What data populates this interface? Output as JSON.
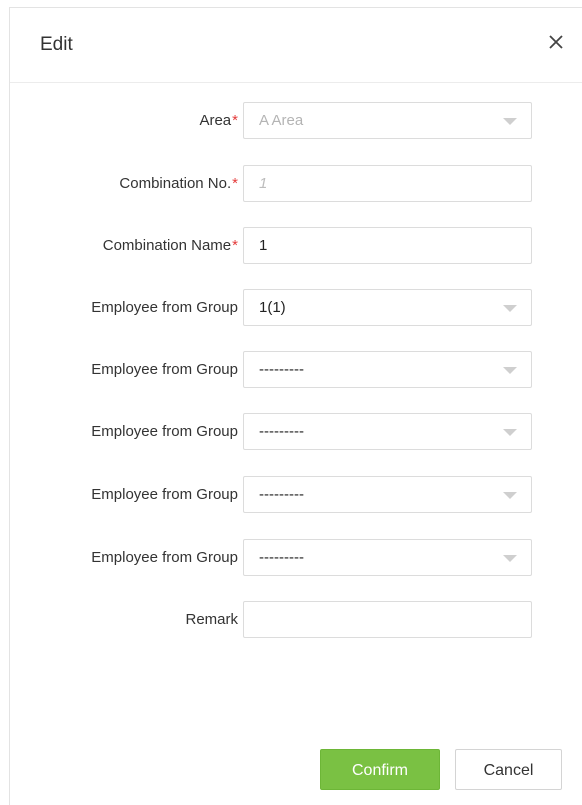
{
  "dialog": {
    "title": "Edit",
    "close_icon": "close-icon"
  },
  "form": {
    "area": {
      "label": "Area",
      "required_mark": "*",
      "value": "A Area"
    },
    "combination_no": {
      "label": "Combination No.",
      "required_mark": "*",
      "placeholder": "1"
    },
    "combination_name": {
      "label": "Combination Name",
      "required_mark": "*",
      "value": "1"
    },
    "groups": [
      {
        "label": "Employee from Group",
        "value": "1(1)"
      },
      {
        "label": "Employee from Group",
        "value": "---------"
      },
      {
        "label": "Employee from Group",
        "value": "---------"
      },
      {
        "label": "Employee from Group",
        "value": "---------"
      },
      {
        "label": "Employee from Group",
        "value": "---------"
      }
    ],
    "remark": {
      "label": "Remark",
      "value": ""
    }
  },
  "buttons": {
    "confirm": "Confirm",
    "cancel": "Cancel"
  },
  "colors": {
    "accent": "#7ac143",
    "required": "#e43a3a"
  }
}
